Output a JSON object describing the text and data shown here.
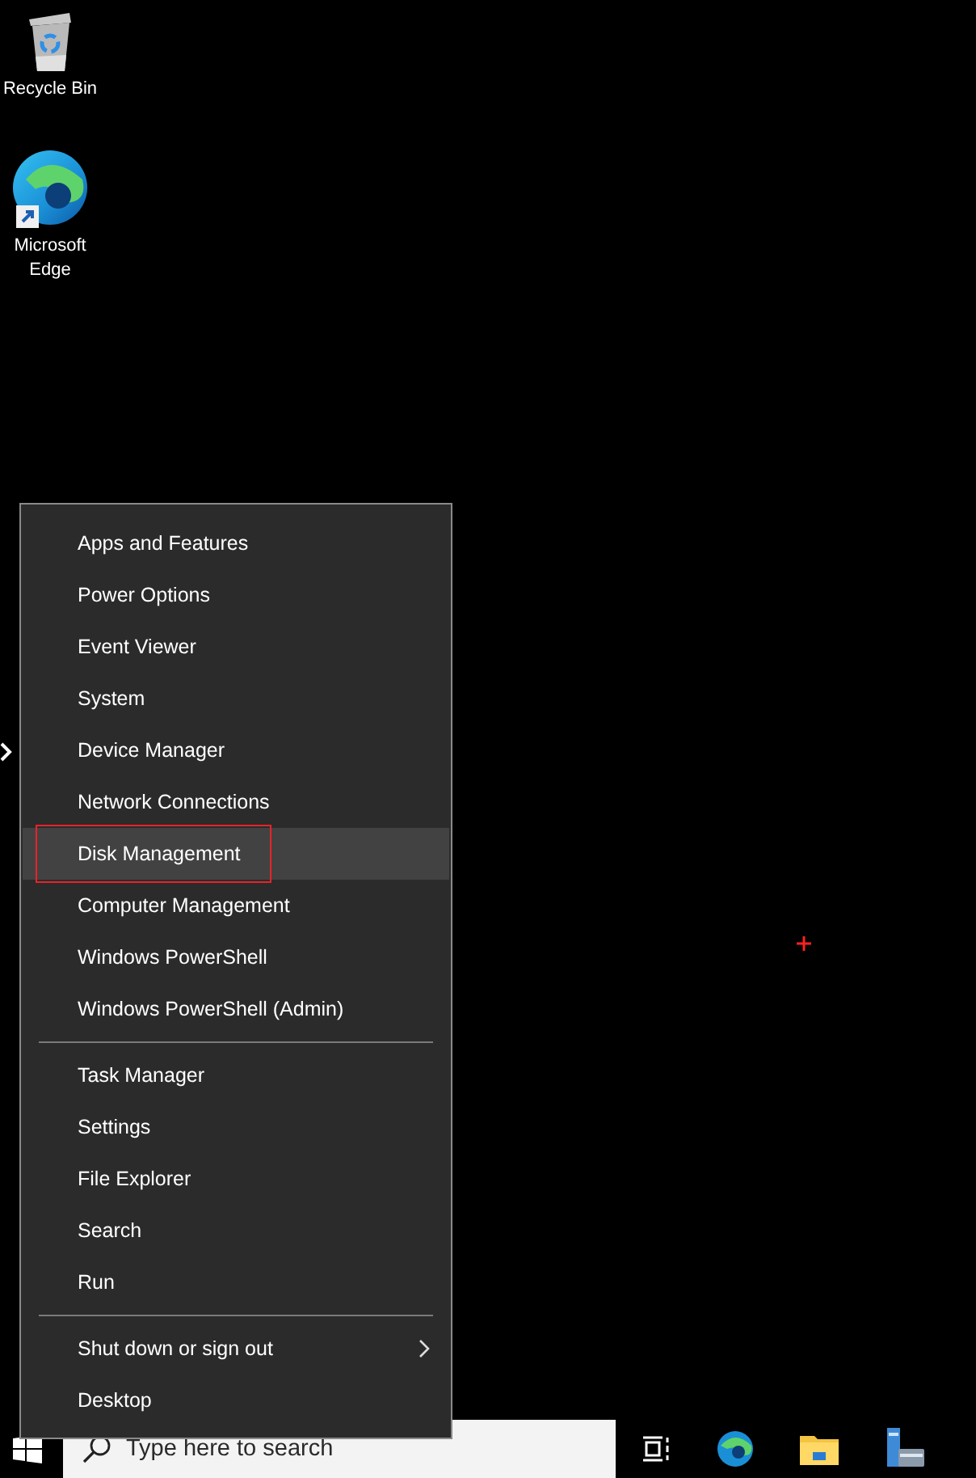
{
  "desktop_icons": [
    {
      "label": "Recycle Bin",
      "kind": "bin"
    },
    {
      "label": "Microsoft Edge",
      "kind": "edge"
    }
  ],
  "menu": {
    "groups": [
      [
        {
          "label": "Apps and Features",
          "selected": false,
          "annotated": false
        },
        {
          "label": "Power Options",
          "selected": false,
          "annotated": false
        },
        {
          "label": "Event Viewer",
          "selected": false,
          "annotated": false
        },
        {
          "label": "System",
          "selected": false,
          "annotated": false
        },
        {
          "label": "Device Manager",
          "selected": false,
          "annotated": false
        },
        {
          "label": "Network Connections",
          "selected": false,
          "annotated": false
        },
        {
          "label": "Disk Management",
          "selected": true,
          "annotated": true
        },
        {
          "label": "Computer Management",
          "selected": false,
          "annotated": false
        },
        {
          "label": "Windows PowerShell",
          "selected": false,
          "annotated": false
        },
        {
          "label": "Windows PowerShell (Admin)",
          "selected": false,
          "annotated": false
        }
      ],
      [
        {
          "label": "Task Manager",
          "selected": false,
          "annotated": false
        },
        {
          "label": "Settings",
          "selected": false,
          "annotated": false
        },
        {
          "label": "File Explorer",
          "selected": false,
          "annotated": false
        },
        {
          "label": "Search",
          "selected": false,
          "annotated": false
        },
        {
          "label": "Run",
          "selected": false,
          "annotated": false
        }
      ],
      [
        {
          "label": "Shut down or sign out",
          "selected": false,
          "annotated": false,
          "submenu": true
        },
        {
          "label": "Desktop",
          "selected": false,
          "annotated": false
        }
      ]
    ]
  },
  "taskbar": {
    "search": {
      "placeholder": "Type here to search"
    }
  }
}
